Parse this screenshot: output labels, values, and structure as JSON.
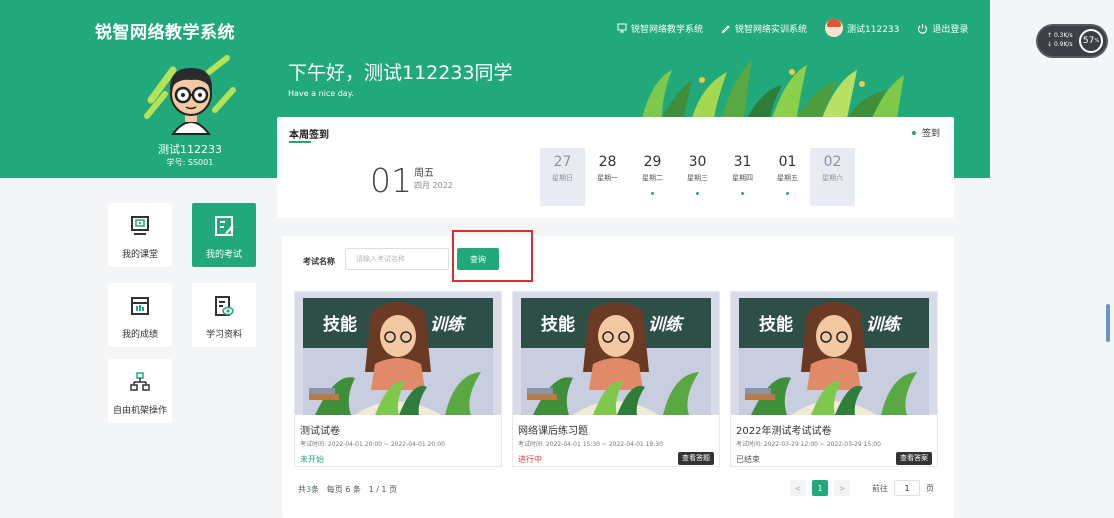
{
  "app": {
    "title": "锐智网络教学系统"
  },
  "top_nav": {
    "teaching_system": "锐智网络教学系统",
    "training_system": "锐智网络实训系统",
    "username": "测试112233",
    "logout": "退出登录"
  },
  "speed_widget": {
    "up": "0.3",
    "down": "0.9",
    "unit": "K/s",
    "percent": "57",
    "percent_unit": "%"
  },
  "profile": {
    "name": "测试112233",
    "student_id": "学号: SS001"
  },
  "greeting": {
    "title": "下午好，测试112233同学",
    "subtitle": "Have a nice day."
  },
  "signin": {
    "title": "本周签到",
    "action": "签到",
    "today_date": "01",
    "today_weekday": "周五",
    "today_month": "四月 2022",
    "days": [
      {
        "num": "27",
        "name": "星期日",
        "signed": false,
        "dim": true
      },
      {
        "num": "28",
        "name": "星期一",
        "signed": false,
        "dim": false
      },
      {
        "num": "29",
        "name": "星期二",
        "signed": true,
        "dim": false
      },
      {
        "num": "30",
        "name": "星期三",
        "signed": true,
        "dim": false
      },
      {
        "num": "31",
        "name": "星期四",
        "signed": true,
        "dim": false
      },
      {
        "num": "01",
        "name": "星期五",
        "signed": true,
        "dim": false
      },
      {
        "num": "02",
        "name": "星期六",
        "signed": false,
        "dim": true
      }
    ]
  },
  "side_menu": [
    {
      "label": "我的课堂",
      "icon": "classroom-icon",
      "active": false
    },
    {
      "label": "我的考试",
      "icon": "exam-icon",
      "active": true
    },
    {
      "label": "我的成绩",
      "icon": "grades-icon",
      "active": false
    },
    {
      "label": "学习资料",
      "icon": "materials-icon",
      "active": false
    },
    {
      "label": "自由机架操作",
      "icon": "rack-icon",
      "active": false
    }
  ],
  "search": {
    "label": "考试名称",
    "placeholder": "请输入考试名称",
    "value": "",
    "button": "查询"
  },
  "exams": [
    {
      "banner_left": "技能",
      "banner_right": "训练",
      "name": "测试试卷",
      "time": "考试时间: 2022-04-01 20:00 ~ 2022-04-01 20:00",
      "status": "未开始",
      "status_color": "#21a97c",
      "button": ""
    },
    {
      "banner_left": "技能",
      "banner_right": "训练",
      "name": "网络课后练习题",
      "time": "考试时间: 2022-04-01 15:30 ~ 2022-04-01 19:30",
      "status": "进行中",
      "status_color": "#e03c3c",
      "button": "查看答题"
    },
    {
      "banner_left": "技能",
      "banner_right": "训练",
      "name": "2022年测试考试试卷",
      "time": "考试时间: 2022-03-29 12:00 ~ 2022-03-29 15:00",
      "status": "已结束",
      "status_color": "#555555",
      "button": "查看答案"
    }
  ],
  "pagination": {
    "total_prefix": "共",
    "total": "3",
    "total_suffix": "条",
    "page_size": "每页 6 条",
    "page_info": "1 / 1 页",
    "prev": "<",
    "current": "1",
    "next": ">",
    "goto_label": "前往",
    "goto_value": "1",
    "goto_suffix": "页"
  },
  "colors": {
    "primary": "#21a97c",
    "highlight": "#d92e2e"
  }
}
